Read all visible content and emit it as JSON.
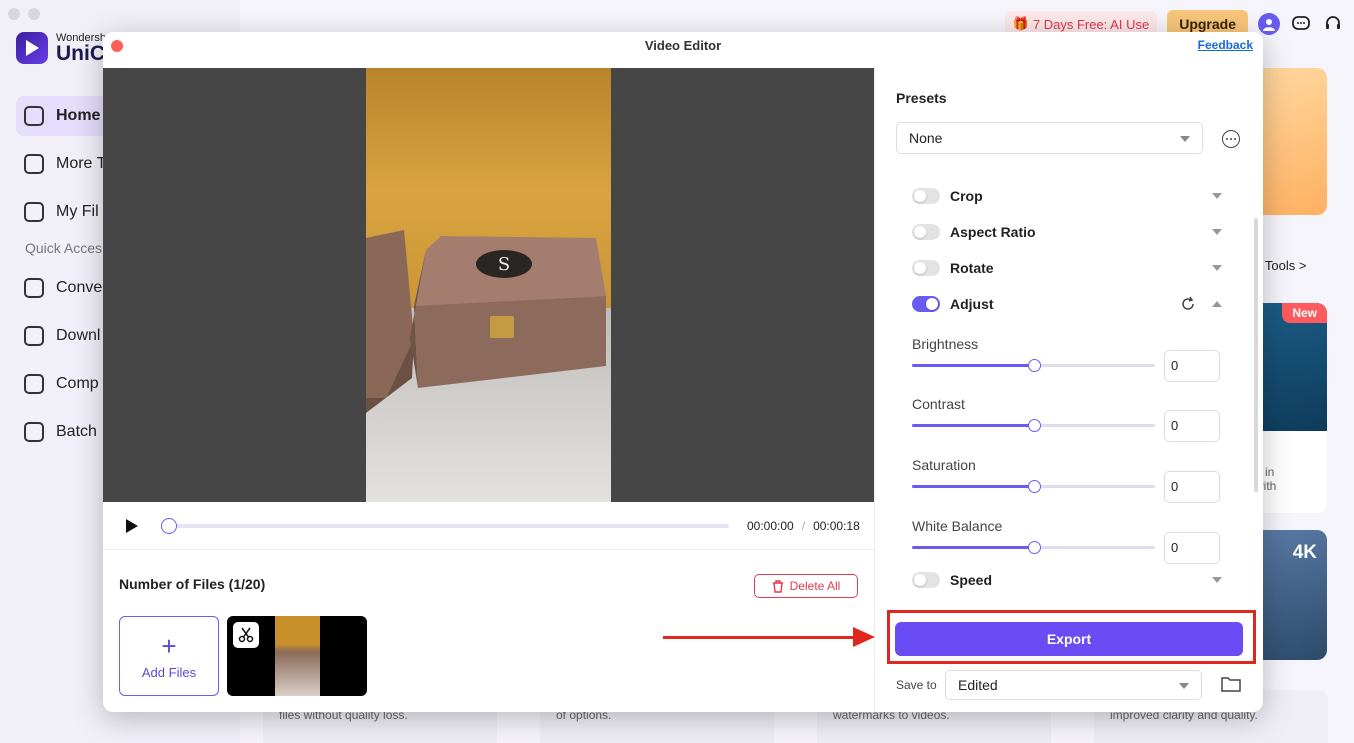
{
  "background_app": {
    "brand_small": "Wondersh",
    "brand_large": "UniCo",
    "nav": [
      {
        "label": "Home",
        "icon": "home-icon"
      },
      {
        "label": "More T",
        "icon": "toolbox-icon"
      },
      {
        "label": "My Fil",
        "icon": "file-icon"
      }
    ],
    "quick_access_label": "Quick Acces",
    "quick_access": [
      {
        "label": "Conve",
        "icon": "convert-icon"
      },
      {
        "label": "Downl",
        "icon": "download-icon"
      },
      {
        "label": "Comp",
        "icon": "compress-icon"
      },
      {
        "label": "Batch",
        "icon": "batch-image-icon"
      }
    ],
    "promo": "7 Days Free: AI Use",
    "upgrade": "Upgrade",
    "more_tools": "re Tools >",
    "new_badge": "New",
    "card_b_text": "h in\nwith",
    "fourk": "4K",
    "bottom_texts": [
      "files without quality loss.",
      "of options.",
      "watermarks to videos.",
      "Al for\nimproved clarity and quality."
    ]
  },
  "editor": {
    "title": "Video Editor",
    "feedback": "Feedback",
    "current_time": "00:00:00",
    "time_sep": "/",
    "duration": "00:00:18",
    "files_title": "Number of Files (1/20)",
    "delete_all": "Delete All",
    "add_files_plus": "+",
    "add_files": "Add Files",
    "presets_label": "Presets",
    "preset_value": "None",
    "sections": {
      "crop": {
        "label": "Crop",
        "enabled": false
      },
      "aspect_ratio": {
        "label": "Aspect Ratio",
        "enabled": false
      },
      "rotate": {
        "label": "Rotate",
        "enabled": false
      },
      "adjust": {
        "label": "Adjust",
        "enabled": true
      },
      "speed": {
        "label": "Speed",
        "enabled": false
      }
    },
    "sliders": [
      {
        "label": "Brightness",
        "value": "0",
        "position": 0.5
      },
      {
        "label": "Contrast",
        "value": "0",
        "position": 0.5
      },
      {
        "label": "Saturation",
        "value": "0",
        "position": 0.5
      },
      {
        "label": "White Balance",
        "value": "0",
        "position": 0.5
      }
    ],
    "export": "Export",
    "save_to_label": "Save to",
    "save_to_value": "Edited"
  },
  "colors": {
    "accent": "#6a5cf0",
    "export": "#6a4cf5",
    "annotation": "#e0261d",
    "danger": "#e23a4e"
  }
}
